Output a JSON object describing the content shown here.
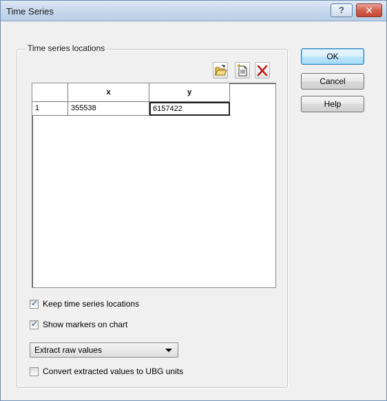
{
  "window": {
    "title": "Time Series",
    "help_glyph": "?",
    "close_glyph": "✕"
  },
  "group": {
    "label": "Time series locations"
  },
  "toolbar": {
    "open_icon": "open-folder-icon",
    "new_icon": "new-document-icon",
    "delete_icon": "delete-x-icon"
  },
  "grid": {
    "headers": [
      "",
      "x",
      "y"
    ],
    "rows": [
      [
        "1",
        "355538",
        "6157422"
      ]
    ]
  },
  "buttons": {
    "ok": "OK",
    "cancel": "Cancel",
    "help": "Help"
  },
  "options": {
    "keep_locations": {
      "label": "Keep time series locations",
      "checked": true
    },
    "show_markers": {
      "label": "Show markers on chart",
      "checked": true
    },
    "extract_mode": {
      "selected": "Extract raw values"
    },
    "convert_units": {
      "label": "Convert extracted values to UBG units",
      "checked": false
    }
  },
  "colors": {
    "accent_border": "#3c7fb1",
    "close_red": "#c24833"
  }
}
